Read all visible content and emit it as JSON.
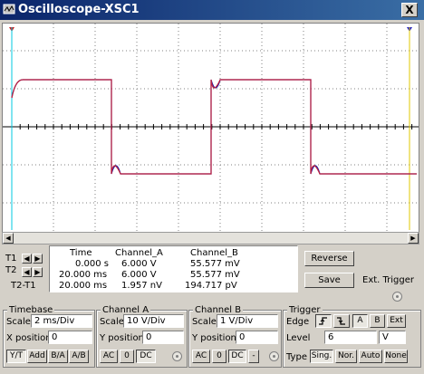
{
  "window": {
    "title": "Oscilloscope-XSC1",
    "close_label": "X"
  },
  "screen": {
    "trace_a_color": "#1a1aa8",
    "trace_b_color": "#c0203c",
    "background": "#ffffff",
    "grid_color": "#000000"
  },
  "cursors": {
    "t1_label": "T1",
    "t2_label": "T2",
    "t2t1_label": "T2-T1"
  },
  "readout": {
    "headers": [
      "Time",
      "Channel_A",
      "Channel_B"
    ],
    "rows": [
      [
        "0.000 s",
        "6.000 V",
        "55.577 mV"
      ],
      [
        "20.000 ms",
        "6.000 V",
        "55.577 mV"
      ],
      [
        "20.000 ms",
        "1.957 nV",
        "194.717 pV"
      ]
    ]
  },
  "actions": {
    "reverse": "Reverse",
    "save": "Save",
    "ext_trigger": "Ext. Trigger"
  },
  "timebase": {
    "title": "Timebase",
    "scale_label": "Scale",
    "scale_value": "2 ms/Div",
    "xpos_label": "X position",
    "xpos_value": "0",
    "modes": [
      "Y/T",
      "Add",
      "B/A",
      "A/B"
    ]
  },
  "channel_a": {
    "title": "Channel A",
    "scale_label": "Scale",
    "scale_value": "10  V/Div",
    "ypos_label": "Y position",
    "ypos_value": "0",
    "coupling": [
      "AC",
      "0",
      "DC"
    ]
  },
  "channel_b": {
    "title": "Channel B",
    "scale_label": "Scale",
    "scale_value": "1  V/Div",
    "ypos_label": "Y position",
    "ypos_value": "0",
    "coupling": [
      "AC",
      "0",
      "DC",
      "-"
    ]
  },
  "trigger": {
    "title": "Trigger",
    "edge_label": "Edge",
    "edge_buttons": [
      "A",
      "B",
      "Ext"
    ],
    "level_label": "Level",
    "level_value": "6",
    "level_unit": "V",
    "type_label": "Type",
    "types": [
      "Sing.",
      "Nor.",
      "Auto",
      "None"
    ]
  }
}
